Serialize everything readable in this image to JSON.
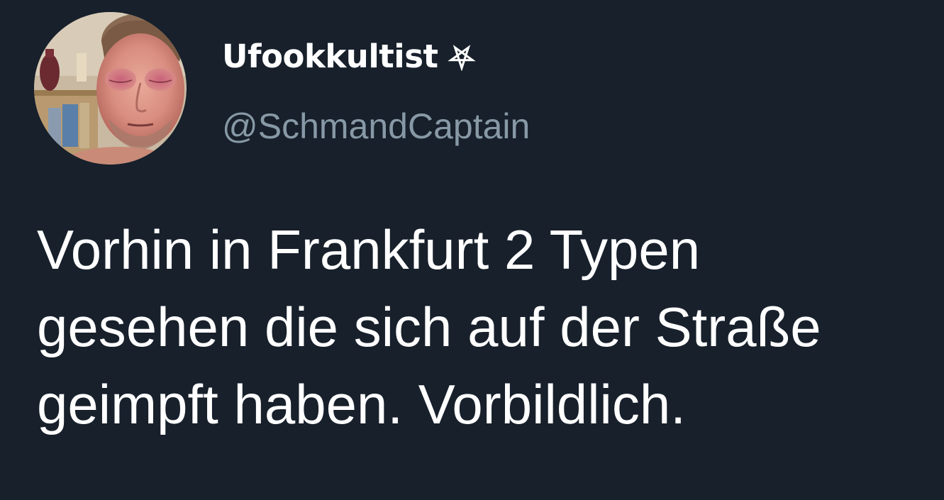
{
  "author": {
    "display_name": "Ufookkultist",
    "name_emoji_icon": "inverted-pentagram-icon",
    "handle": "@SchmandCaptain",
    "avatar": "profile-photo"
  },
  "tweet": {
    "lines": [
      "Vorhin in Frankfurt 2 Typen",
      "gesehen die sich auf der Straße",
      "geimpft haben. Vorbildlich."
    ]
  },
  "colors": {
    "background": "#17202b",
    "text": "#ffffff",
    "handle": "#8899a6"
  }
}
